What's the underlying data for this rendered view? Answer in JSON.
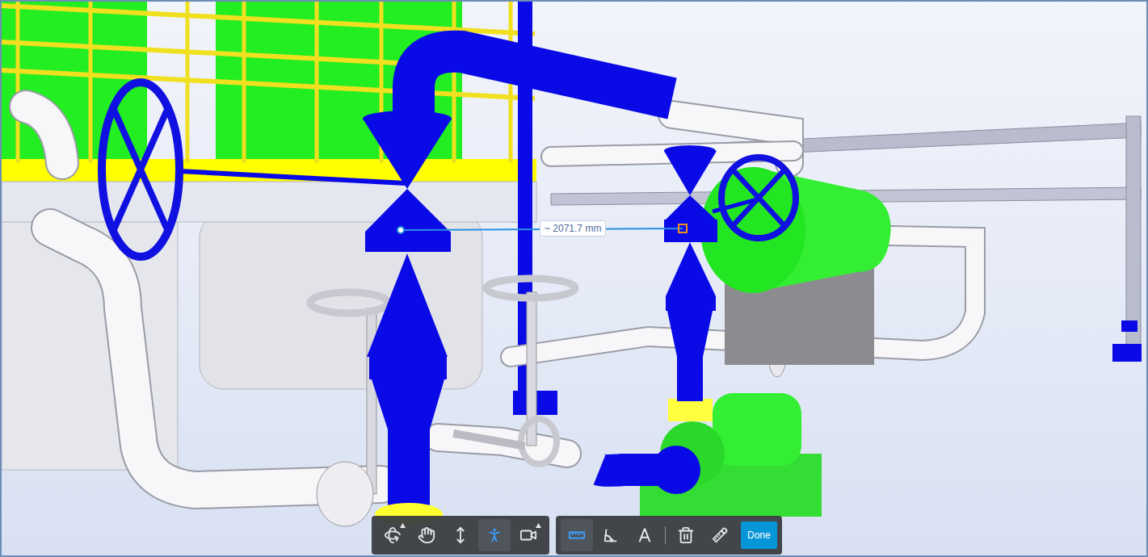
{
  "viewer": {
    "measurement": {
      "label": "~ 2071.7 mm"
    }
  },
  "toolbar": {
    "navigation": [
      {
        "kind": "orbit",
        "selected": false,
        "has_menu": true
      },
      {
        "kind": "pan",
        "selected": false,
        "has_menu": false
      },
      {
        "kind": "zoom",
        "selected": false,
        "has_menu": false
      },
      {
        "kind": "firstperson",
        "selected": true,
        "has_menu": false
      },
      {
        "kind": "camera",
        "selected": false,
        "has_menu": true
      }
    ],
    "measure": [
      {
        "kind": "distance",
        "selected": true
      },
      {
        "kind": "angle",
        "selected": false
      },
      {
        "kind": "area",
        "selected": false
      }
    ],
    "actions": [
      {
        "kind": "delete"
      },
      {
        "kind": "settings"
      }
    ],
    "done_button": "Done"
  }
}
